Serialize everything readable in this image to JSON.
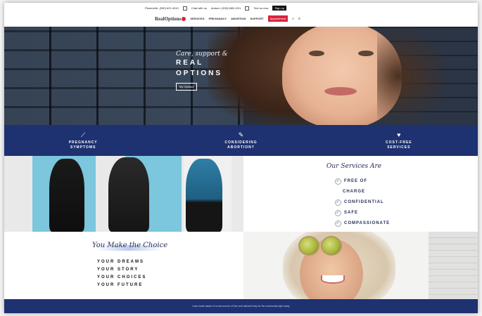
{
  "header": {
    "utility_links": [
      "Placerville: (530) 621-4010",
      "Chat with us",
      "Auburn: (530) 885-1201",
      "Text us now",
      "Sign up"
    ],
    "logo_text": "RealOptions",
    "nav_items": [
      "SERVICES",
      "PREGNANCY",
      "ABORTION",
      "SUPPORT"
    ],
    "nav_cta": "Appointment",
    "nav_icons": [
      "search-icon",
      "menu-icon"
    ]
  },
  "hero": {
    "script_line": "Care, support &",
    "title_line1": "REAL",
    "title_line2": "OPTIONS",
    "button_label": "My Options"
  },
  "features": [
    {
      "icon": "pen-icon",
      "glyph": "⟋",
      "label": "PREGNANCY\nSYMPTOMS"
    },
    {
      "icon": "pen-icon",
      "glyph": "✎",
      "label": "CONSIDERING\nABORTION?"
    },
    {
      "icon": "heart-icon",
      "glyph": "♥",
      "label": "COST-FREE\nSERVICES"
    }
  ],
  "services": {
    "title": "Our Services Are",
    "items": [
      "FREE OF",
      "CONFIDENTIAL",
      "SAFE",
      "COMPASSIONATE"
    ],
    "continuation": "CHARGE"
  },
  "make_the_choice": {
    "title": "You Make the Choice",
    "items": [
      "YOUR DREAMS",
      "YOUR STORY",
      "YOUR CHOICES",
      "YOUR FUTURE"
    ]
  },
  "footer": {
    "text": "I was made aware of a new source of free and discreet help for the community right away."
  },
  "colors": {
    "navy": "#1e3170",
    "accent_red": "#d7263d",
    "wall_blue": "#7cc6de"
  }
}
